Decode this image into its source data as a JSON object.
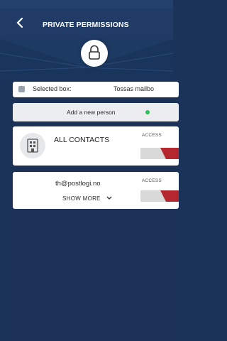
{
  "header": {
    "title": "PRIVATE PERMISSIONS",
    "back_icon": "chevron-left-icon",
    "lock_icon": "lock-icon"
  },
  "selected_box": {
    "label": "Selected box:",
    "value": "Tossas mailbo"
  },
  "add_person": {
    "label": "Add a new person",
    "status_color": "#2fbf5b"
  },
  "permissions": [
    {
      "name": "ALL CONTACTS",
      "icon": "building-icon",
      "access_label": "ACCESS",
      "toggle_color": "#b5272f"
    },
    {
      "email": "th@postlogi.no",
      "show_more_label": "SHOW MORE",
      "access_label": "ACCESS",
      "toggle_color": "#b5272f"
    }
  ],
  "colors": {
    "background": "#1b3358",
    "header": "#1f3b66",
    "card": "#ffffff",
    "accent_red": "#b5272f"
  }
}
